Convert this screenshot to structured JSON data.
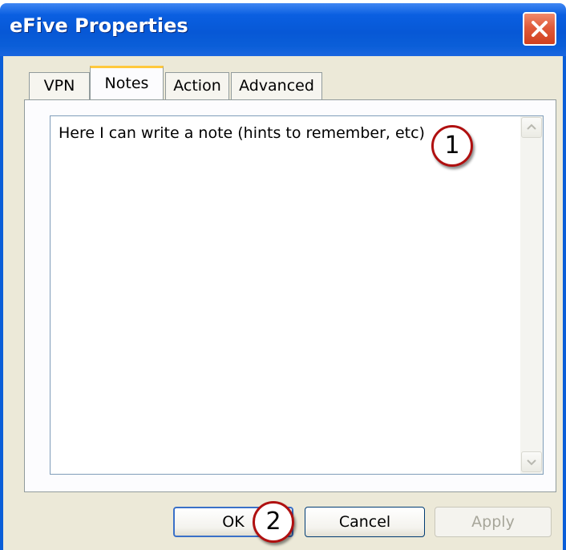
{
  "window": {
    "title": "eFive Properties"
  },
  "tabs": [
    {
      "label": "VPN",
      "active": false
    },
    {
      "label": "Notes",
      "active": true
    },
    {
      "label": "Action",
      "active": false
    },
    {
      "label": "Advanced",
      "active": false
    }
  ],
  "notes": {
    "text": "Here I can write a note (hints to remember, etc)"
  },
  "annotations": {
    "step1": "1",
    "step2": "2"
  },
  "buttons": {
    "ok": "OK",
    "cancel": "Cancel",
    "apply": "Apply"
  },
  "colors": {
    "titlebar": "#0a5ed8",
    "client_bg": "#ece9d8",
    "active_tab_accent": "#ffc83c",
    "close_button": "#e05a3a",
    "badge_ring": "#b01010"
  },
  "icons": {
    "close": "close-icon",
    "scroll_up": "chevron-up-icon",
    "scroll_down": "chevron-down-icon"
  }
}
